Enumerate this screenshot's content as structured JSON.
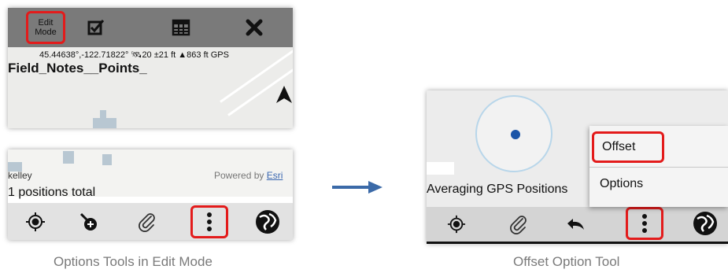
{
  "panel_edit_mode": {
    "toolbar": {
      "edit_mode_line1": "Edit",
      "edit_mode_line2": "Mode",
      "icons": [
        "checkbox-icon",
        "table-icon",
        "close-icon"
      ]
    },
    "status": {
      "coordinates": "45.44638°,-122.71822°",
      "satellites": "20",
      "accuracy": "±21 ft",
      "elevation": "863 ft",
      "source": "GPS"
    },
    "layer_title": "Field_Notes__Points_",
    "user": "kelley",
    "powered_by": "Powered by",
    "powered_by_link": "Esri",
    "positions_total": "1 positions total",
    "bottom_icons": [
      "gps-target-icon",
      "collect-icon",
      "attachment-icon",
      "more-vertical-icon",
      "esri-globe-icon"
    ]
  },
  "panel_offset": {
    "averaging_label": "Averaging GPS Positions",
    "menu": {
      "offset": "Offset",
      "options": "Options"
    },
    "bottom_icons": [
      "gps-target-icon",
      "attachment-icon",
      "undo-icon",
      "more-vertical-icon",
      "esri-globe-icon"
    ]
  },
  "captions": {
    "left": "Options Tools in Edit Mode",
    "right": "Offset Option Tool"
  },
  "colors": {
    "highlight": "#e31b1b",
    "toolbar": "#7a7a7a",
    "arrow": "#3b6aa8",
    "gps_dot": "#1b55a8"
  }
}
